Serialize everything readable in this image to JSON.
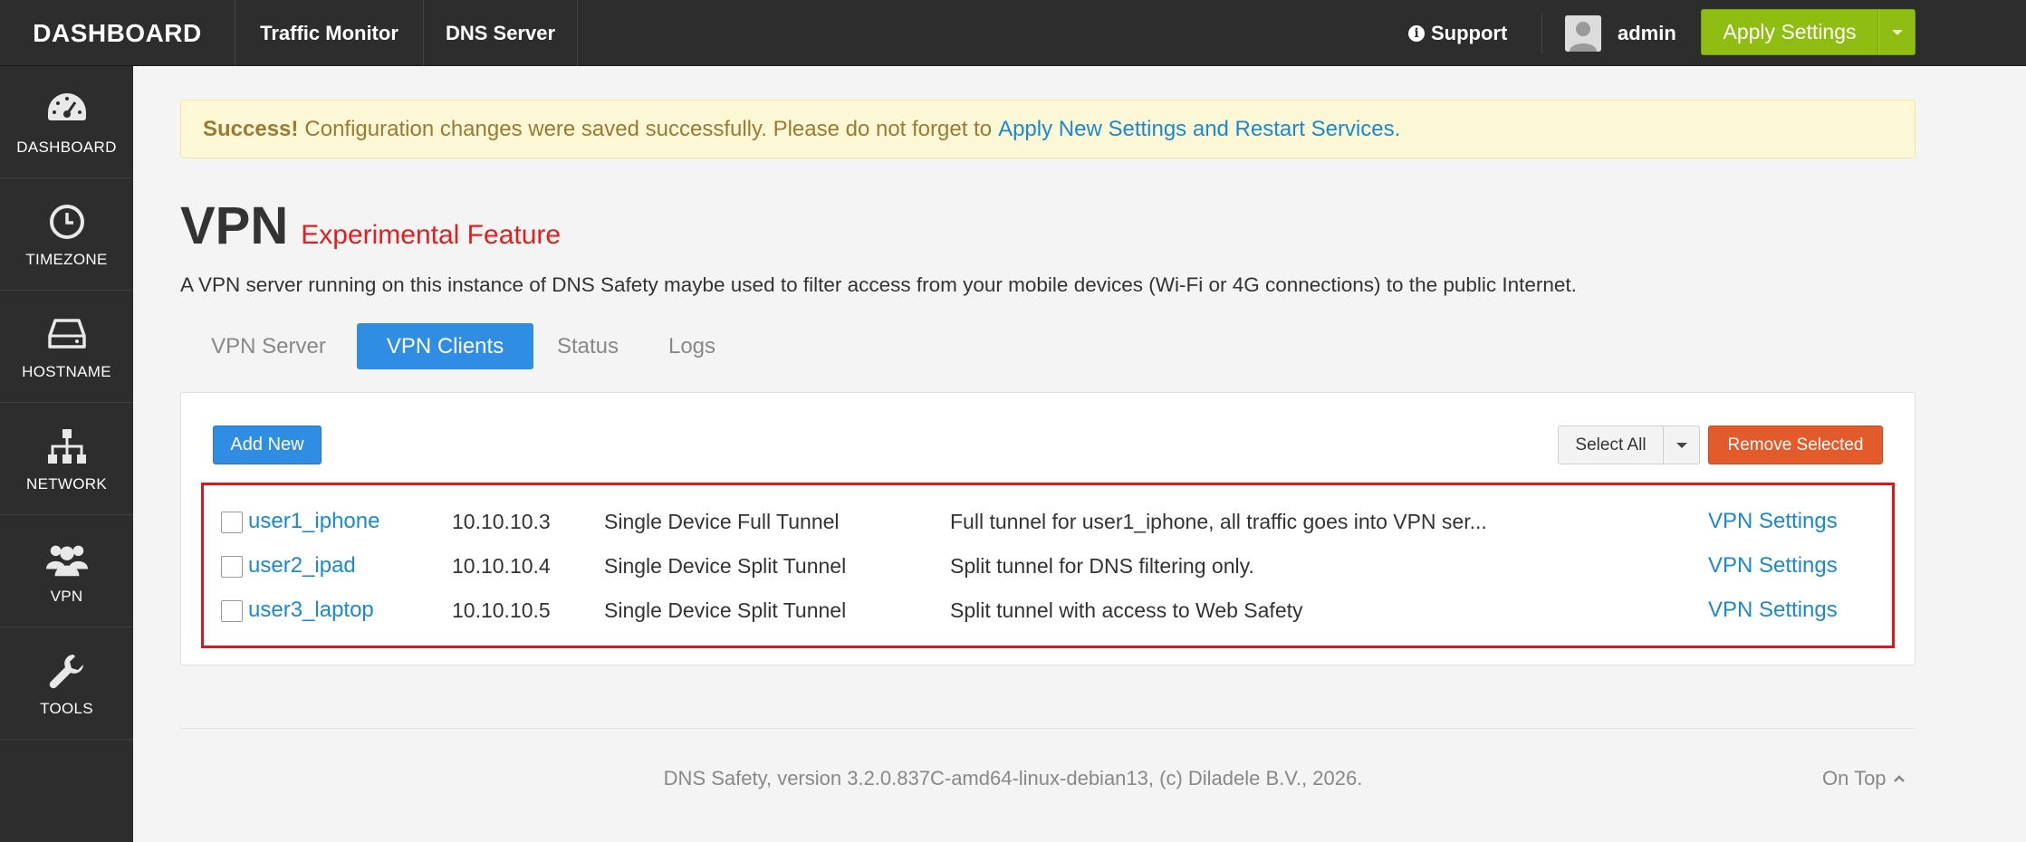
{
  "topbar": {
    "brand": "DASHBOARD",
    "nav": [
      "Traffic Monitor",
      "DNS Server"
    ],
    "support": "Support",
    "user": "admin",
    "apply": "Apply Settings"
  },
  "sidebar": {
    "items": [
      {
        "label": "DASHBOARD",
        "icon": "dashboard-icon"
      },
      {
        "label": "TIMEZONE",
        "icon": "clock-icon"
      },
      {
        "label": "HOSTNAME",
        "icon": "harddrive-icon"
      },
      {
        "label": "NETWORK",
        "icon": "network-icon"
      },
      {
        "label": "VPN",
        "icon": "users-icon"
      },
      {
        "label": "TOOLS",
        "icon": "wrench-icon"
      }
    ]
  },
  "alert": {
    "strong": "Success!",
    "text": "Configuration changes were saved successfully. Please do not forget to",
    "link": "Apply New Settings and Restart Services."
  },
  "page": {
    "title": "VPN",
    "badge": "Experimental Feature",
    "description": "A VPN server running on this instance of DNS Safety maybe used to filter access from your mobile devices (Wi-Fi or 4G connections) to the public Internet."
  },
  "tabs": [
    "VPN Server",
    "VPN Clients",
    "Status",
    "Logs"
  ],
  "toolbar": {
    "add": "Add New",
    "select_all": "Select All",
    "remove": "Remove Selected"
  },
  "clients": [
    {
      "name": "user1_iphone",
      "ip": "10.10.10.3",
      "type": "Single Device Full Tunnel",
      "desc": "Full tunnel for user1_iphone, all traffic goes into VPN ser...",
      "action": "VPN Settings"
    },
    {
      "name": "user2_ipad",
      "ip": "10.10.10.4",
      "type": "Single Device Split Tunnel",
      "desc": "Split tunnel for DNS filtering only.",
      "action": "VPN Settings"
    },
    {
      "name": "user3_laptop",
      "ip": "10.10.10.5",
      "type": "Single Device Split Tunnel",
      "desc": "Split tunnel with access to Web Safety",
      "action": "VPN Settings"
    }
  ],
  "footer": {
    "text": "DNS Safety, version 3.2.0.837C-amd64-linux-debian13, (c) Diladele B.V., 2026.",
    "ontop": "On Top"
  },
  "colors": {
    "accent": "#2f8de4",
    "apply": "#8fbd12",
    "danger": "#e35b2a",
    "link": "#1a8ad0",
    "highlight": "#e0141e"
  }
}
